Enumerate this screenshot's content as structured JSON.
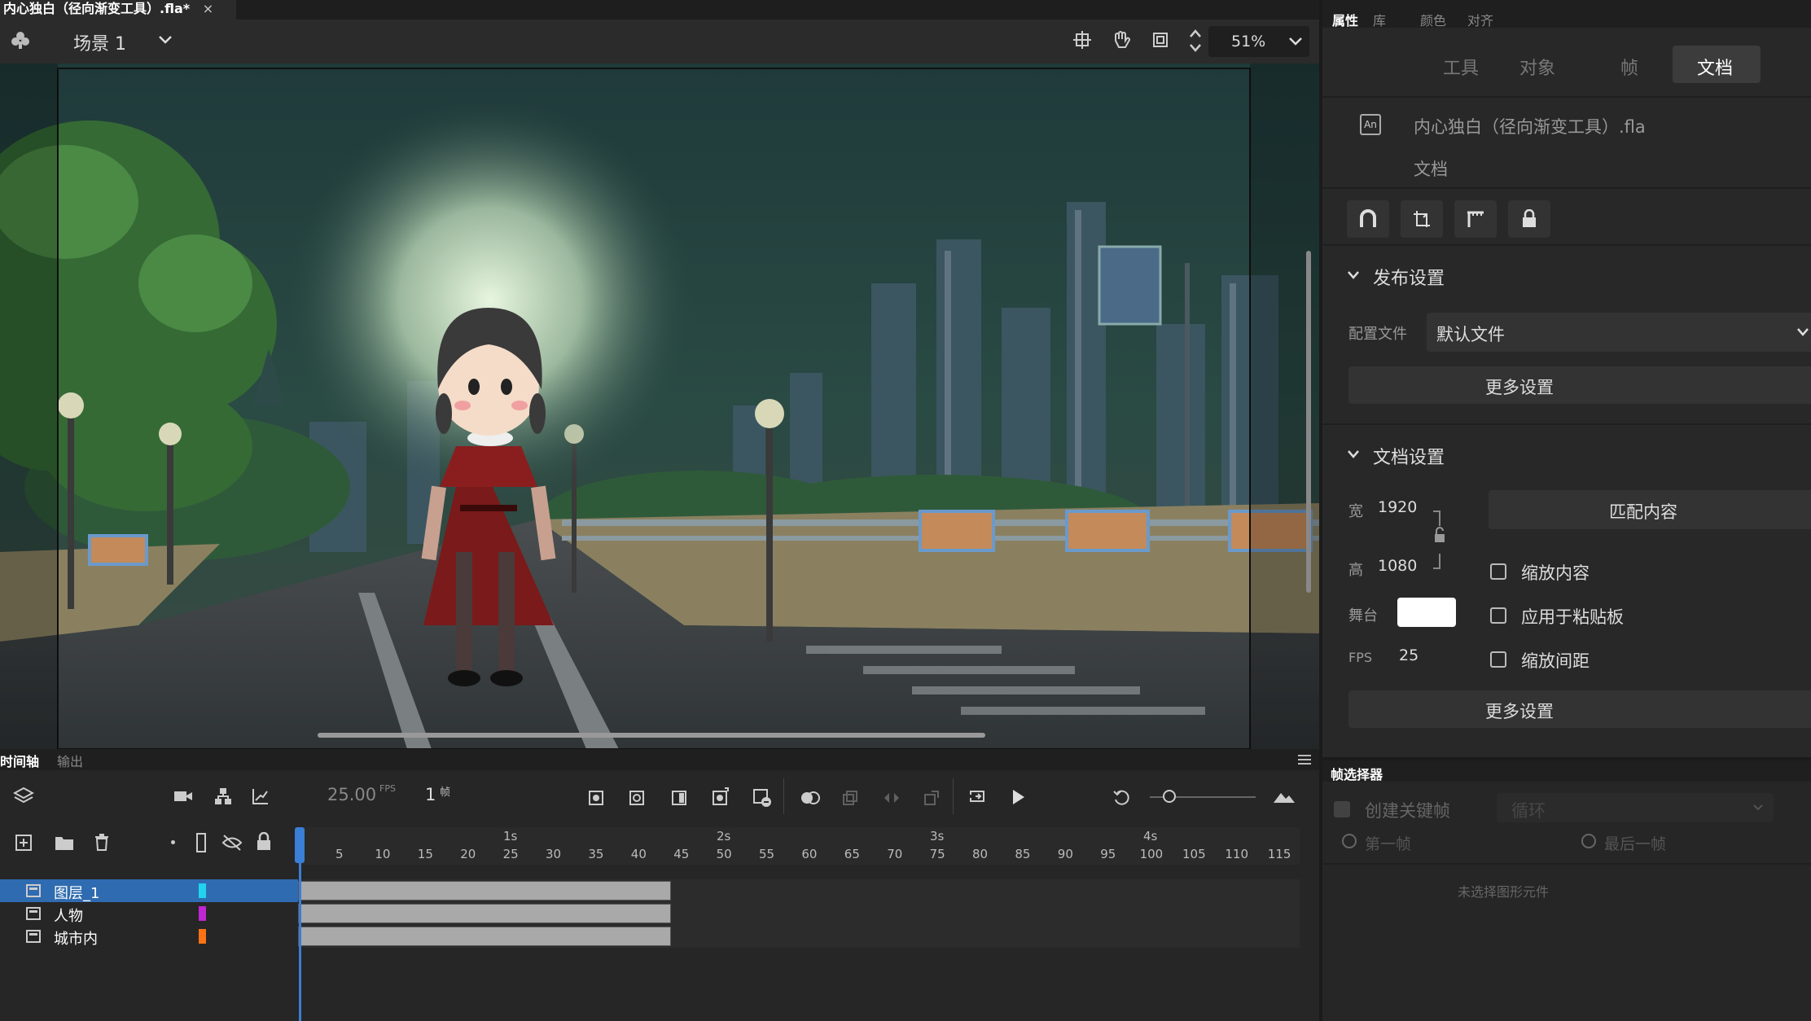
{
  "document_tab": {
    "title": "内心独白（径向渐变工具）.fla*",
    "close": "×"
  },
  "toolbar": {
    "scene_label": "场景 1",
    "zoom": "51%"
  },
  "timeline": {
    "tabs": [
      "时间轴",
      "输出"
    ],
    "fps": "25.00",
    "fps_unit": "FPS",
    "frame": "1",
    "frame_unit": "帧",
    "seconds": [
      "1s",
      "2s",
      "3s",
      "4s"
    ],
    "frame_numbers": [
      "5",
      "10",
      "15",
      "20",
      "25",
      "30",
      "35",
      "40",
      "45",
      "50",
      "55",
      "60",
      "65",
      "70",
      "75",
      "80",
      "85",
      "90",
      "95",
      "100",
      "105",
      "110",
      "115"
    ],
    "layers": [
      {
        "name": "图层_1",
        "color": "#22d3ee",
        "selected": true
      },
      {
        "name": "人物",
        "color": "#c026d3",
        "selected": false
      },
      {
        "name": "城市内",
        "color": "#f97316",
        "selected": false
      }
    ]
  },
  "properties": {
    "tabs": [
      "属性",
      "库",
      "颜色",
      "对齐"
    ],
    "sub_tabs": [
      "工具",
      "对象",
      "帧",
      "文档"
    ],
    "doc_icon": "An",
    "filename": "内心独白（径向渐变工具）.fla",
    "type": "文档",
    "publish": {
      "title": "发布设置",
      "profile_label": "配置文件",
      "profile_value": "默认文件",
      "more": "更多设置"
    },
    "doc_settings": {
      "title": "文档设置",
      "width_label": "宽",
      "width": "1920",
      "height_label": "高",
      "height": "1080",
      "match": "匹配内容",
      "scale_content": "缩放内容",
      "apply_paste": "应用于粘贴板",
      "scale_spacing": "缩放间距",
      "stage_label": "舞台",
      "stage_color": "#ffffff",
      "fps_label": "FPS",
      "fps": "25",
      "more": "更多设置"
    }
  },
  "frame_picker": {
    "title": "帧选择器",
    "create_keyframe": "创建关键帧",
    "loop": "循环",
    "first": "第一帧",
    "last": "最后一帧",
    "empty": "未选择图形元件"
  }
}
